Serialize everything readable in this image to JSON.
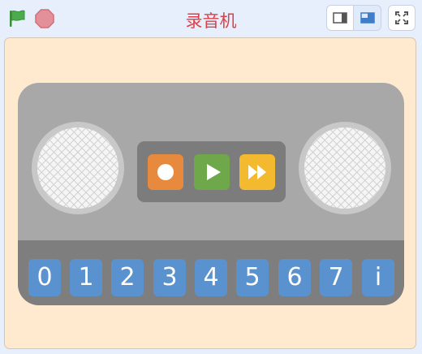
{
  "header": {
    "title": "录音机",
    "colors": {
      "flag": "#4cab4a",
      "stop": "#e3909a",
      "title": "#d9414b"
    }
  },
  "stage": {
    "background": "#ffe9cf",
    "player_colors": {
      "body": "#a8a8a8",
      "strip": "#7e7e7e"
    },
    "transport": [
      {
        "name": "record",
        "icon": "record-icon",
        "color": "#e88a3d"
      },
      {
        "name": "play",
        "icon": "play-icon",
        "color": "#6fa84a"
      },
      {
        "name": "fast-forward",
        "icon": "fast-forward-icon",
        "color": "#f3b92f"
      }
    ],
    "keys": [
      "0",
      "1",
      "2",
      "3",
      "4",
      "5",
      "6",
      "7",
      "i"
    ]
  }
}
